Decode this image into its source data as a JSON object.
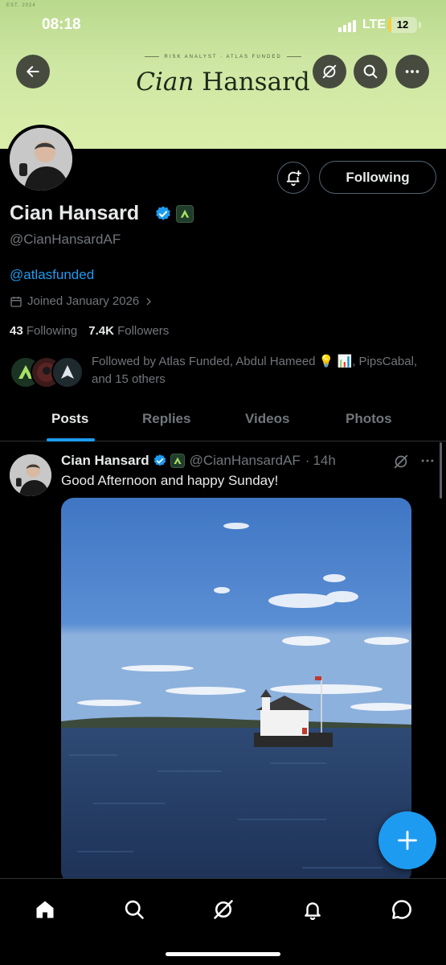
{
  "status_bar": {
    "time": "08:18",
    "network": "LTE",
    "battery": "12",
    "battery_level": 0.12
  },
  "banner": {
    "est": "EST. 2024",
    "tagline": "RISK ANALYST · ATLAS FUNDED",
    "brand_first": "Cian",
    "brand_last": "Hansard"
  },
  "profile": {
    "name": "Cian Hansard",
    "handle": "@CianHansardAF",
    "link": "@atlasfunded",
    "joined": "Joined January 2026",
    "following_count": "43",
    "following_label": "Following",
    "followers_count": "7.4K",
    "followers_label": "Followers",
    "follow_button": "Following",
    "followed_by": "Followed by Atlas Funded, Abdul Hameed 💡 📊, PipsCabal, and 15 others"
  },
  "tabs": [
    "Posts",
    "Replies",
    "Videos",
    "Photos"
  ],
  "active_tab": "Posts",
  "post": {
    "name": "Cian Hansard",
    "handle": "@CianHansardAF",
    "time": "14h",
    "text": "Good Afternoon and happy Sunday!"
  },
  "icons": {
    "back": "arrow-left-icon",
    "grok": "grok-icon",
    "search": "search-icon",
    "more": "more-icon",
    "bell": "bell-plus-icon",
    "calendar": "calendar-icon",
    "home": "home-icon",
    "notifications": "bell-icon",
    "messages": "message-icon",
    "compose": "plus-icon"
  },
  "colors": {
    "accent": "#1d9bf0",
    "banner": "#cfe7a4",
    "affiliate_badge": "#1f3d2a",
    "muted": "#71767b"
  }
}
